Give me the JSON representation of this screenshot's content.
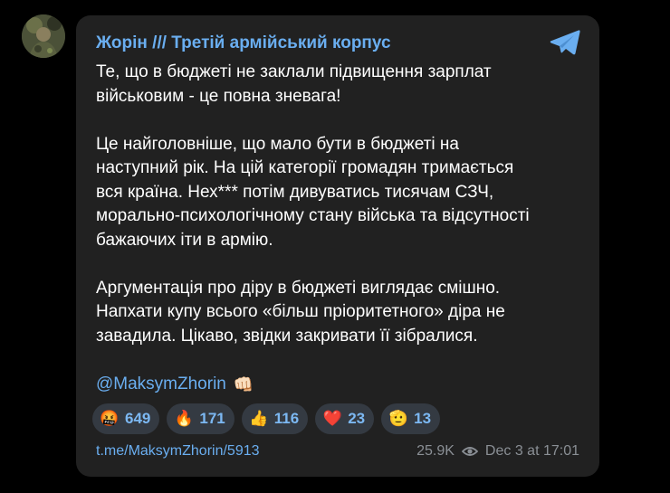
{
  "post": {
    "author": "Жорін /// Третій армійський корпус",
    "paragraphs": [
      "Те, що в бюджеті не заклали підвищення зарплат\nвійськовим - це повна зневага!",
      "Це найголовніше, що мало бути в бюджеті на\nнаступний рік. На цій категорії громадян тримається\nвся країна. Нех*** потім дивуватись тисячам СЗЧ,\nморально-психологічному стану війська та відсутності\nбажаючих іти в армію.",
      "Аргументація про діру в бюджеті виглядає смішно.\nНапхати купу всього «більш пріоритетного» діра не\nзавадила. Цікаво, звідки закривати її зібралися."
    ],
    "mention": "@MaksymZhorin",
    "mention_emoji": "👊🏻",
    "link": "t.me/MaksymZhorin/5913",
    "views": "25.9K",
    "date": "Dec 3 at 17:01"
  },
  "reactions": [
    {
      "icon": "swearing-face-icon",
      "emoji": "🤬",
      "count": "649"
    },
    {
      "icon": "fire-icon",
      "emoji": "🔥",
      "count": "171"
    },
    {
      "icon": "thumbs-up-icon",
      "emoji": "👍",
      "count": "116"
    },
    {
      "icon": "heart-icon",
      "emoji": "❤️",
      "count": "23"
    },
    {
      "icon": "pointing-hand-icon",
      "emoji": "🫡",
      "count": "13"
    }
  ],
  "colors": {
    "background": "#000000",
    "card": "#212121",
    "accent": "#6aaef0",
    "text": "#ffffff",
    "muted": "#8a8f95",
    "reaction_bg": "#343a42"
  }
}
